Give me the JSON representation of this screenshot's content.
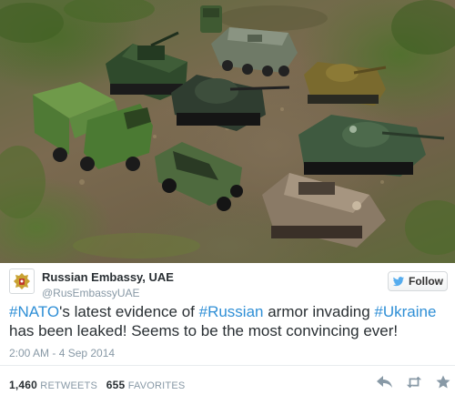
{
  "photo": {
    "alt_icon": "photo-of-toy-military-vehicles",
    "vehicles": [
      "toy-army-truck",
      "toy-self-propelled-gun",
      "toy-tank-center",
      "toy-armored-personnel-carrier",
      "toy-tan-tank",
      "toy-jeep",
      "toy-amphibious-tank",
      "toy-amphibious-car",
      "toy-small-truck"
    ]
  },
  "tweet": {
    "account_name": "Russian Embassy, UAE",
    "handle": "@RusEmbassyUAE",
    "follow_label": "Follow",
    "text_parts": {
      "h1": "#NATO",
      "t1": "'s latest evidence of ",
      "h2": "#Russian",
      "t2": " armor invading ",
      "h3": "#Ukraine",
      "t3": " has been leaked! Seems to be the most convincing ever!"
    },
    "timestamp": "2:00 AM - 4 Sep 2014",
    "retweets_count": "1,460",
    "retweets_label": "RETWEETS",
    "favorites_count": "655",
    "favorites_label": "FAVORITES"
  },
  "colors": {
    "hashtag": "#2f8fd6",
    "text": "#292f33",
    "muted": "#8899a6"
  },
  "icons": {
    "avatar": "coat-of-arms-icon",
    "follow": "twitter-bird-icon",
    "reply": "reply-icon",
    "retweet": "retweet-icon",
    "favorite": "star-icon"
  }
}
